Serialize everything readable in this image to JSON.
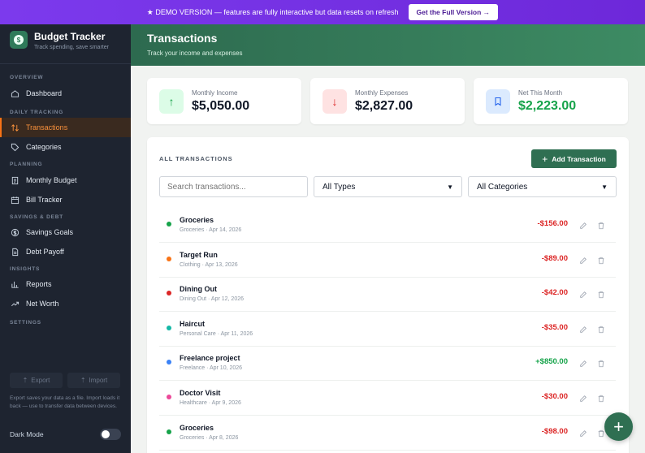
{
  "banner": {
    "text": "★ DEMO VERSION — features are fully interactive but data resets on refresh",
    "button": "Get the Full Version →"
  },
  "brand": {
    "title": "Budget Tracker",
    "subtitle": "Track spending, save smarter"
  },
  "sections": {
    "overview": "OVERVIEW",
    "daily": "DAILY TRACKING",
    "planning": "PLANNING",
    "savings": "SAVINGS & DEBT",
    "insights": "INSIGHTS",
    "settings": "SETTINGS"
  },
  "nav": {
    "dashboard": "Dashboard",
    "transactions": "Transactions",
    "categories": "Categories",
    "monthly_budget": "Monthly Budget",
    "bill_tracker": "Bill Tracker",
    "savings_goals": "Savings Goals",
    "debt_payoff": "Debt Payoff",
    "reports": "Reports",
    "net_worth": "Net Worth"
  },
  "settings": {
    "export": "Export",
    "import": "Import",
    "note": "Export saves your data as a file. Import loads it back — use to transfer data between devices.",
    "dark_mode": "Dark Mode",
    "dark_mode_on": false
  },
  "header": {
    "title": "Transactions",
    "subtitle": "Track your income and expenses"
  },
  "summary": {
    "income": {
      "label": "Monthly Income",
      "value": "$5,050.00",
      "icon": "arrow-up-icon"
    },
    "expenses": {
      "label": "Monthly Expenses",
      "value": "$2,827.00",
      "icon": "arrow-down-icon"
    },
    "net": {
      "label": "Net This Month",
      "value": "$2,223.00",
      "icon": "bookmark-icon"
    }
  },
  "panel": {
    "title": "ALL TRANSACTIONS",
    "add_button": "Add Transaction",
    "search_placeholder": "Search transactions...",
    "type_filter": "All Types",
    "category_filter": "All Categories"
  },
  "transactions": [
    {
      "name": "Groceries",
      "meta": "Groceries · Apr 14, 2026",
      "amount": "-$156.00",
      "dot": "#16a34a"
    },
    {
      "name": "Target Run",
      "meta": "Clothing · Apr 13, 2026",
      "amount": "-$89.00",
      "dot": "#f97316"
    },
    {
      "name": "Dining Out",
      "meta": "Dining Out · Apr 12, 2026",
      "amount": "-$42.00",
      "dot": "#dc2626"
    },
    {
      "name": "Haircut",
      "meta": "Personal Care · Apr 11, 2026",
      "amount": "-$35.00",
      "dot": "#14b8a6"
    },
    {
      "name": "Freelance project",
      "meta": "Freelance · Apr 10, 2026",
      "amount": "+$850.00",
      "dot": "#3b82f6"
    },
    {
      "name": "Doctor Visit",
      "meta": "Healthcare · Apr 9, 2026",
      "amount": "-$30.00",
      "dot": "#ec4899"
    },
    {
      "name": "Groceries",
      "meta": "Groceries · Apr 8, 2026",
      "amount": "-$98.00",
      "dot": "#16a34a"
    }
  ],
  "colors": {
    "negative": "#dc2626",
    "positive": "#16a34a",
    "accent": "#2f6f52",
    "active_nav": "#fb923c"
  }
}
